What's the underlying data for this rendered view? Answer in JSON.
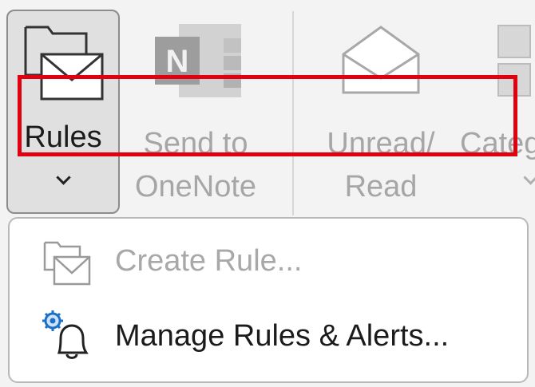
{
  "ribbon": {
    "rules": {
      "label": "Rules",
      "icon": "rules-icon"
    },
    "send_to_onenote": {
      "label_line1": "Send to",
      "label_line2": "OneNote",
      "icon": "onenote-icon"
    },
    "unread_read": {
      "label_line1": "Unread/",
      "label_line2": "Read",
      "icon": "envelope-open-icon"
    },
    "categorize": {
      "label": "Categ",
      "icon": "categorize-icon"
    }
  },
  "menu": {
    "items": [
      {
        "label": "Create Rule...",
        "icon": "create-rule-icon",
        "enabled": false
      },
      {
        "label": "Manage Rules & Alerts...",
        "icon": "manage-rules-alerts-icon",
        "enabled": true,
        "highlighted": true
      }
    ]
  },
  "colors": {
    "highlight": "#e0000f",
    "disabled_text": "#a8a8a8",
    "text": "#1b1b1b"
  }
}
